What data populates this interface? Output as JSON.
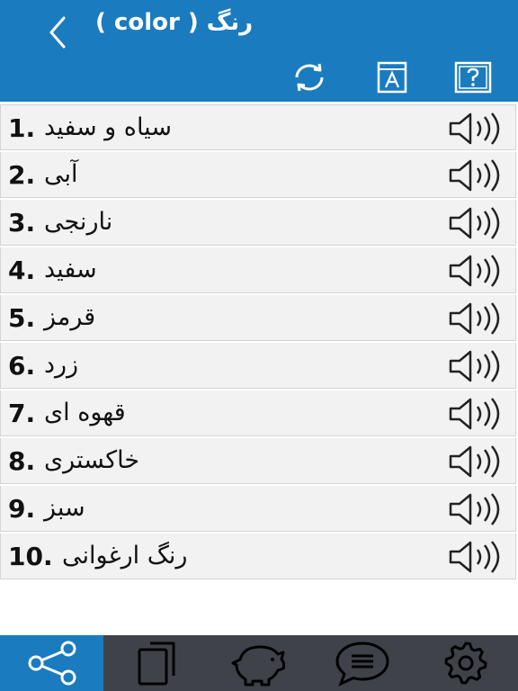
{
  "header": {
    "title": "( color ) رنگ",
    "back_icon": "chevron-left-icon",
    "tools": [
      "refresh-icon",
      "dictionary-icon",
      "help-icon"
    ],
    "color": "#1a7bbf"
  },
  "items": [
    {
      "number": "1.",
      "word": "سیاه و سفید"
    },
    {
      "number": "2.",
      "word": "آبی"
    },
    {
      "number": "3.",
      "word": "نارنجی"
    },
    {
      "number": "4.",
      "word": "سفید"
    },
    {
      "number": "5.",
      "word": "قرمز"
    },
    {
      "number": "6.",
      "word": "زرد"
    },
    {
      "number": "7.",
      "word": "قهوه ای"
    },
    {
      "number": "8.",
      "word": "خاکستری"
    },
    {
      "number": "9.",
      "word": "سبز"
    },
    {
      "number": "10.",
      "word": "رنگ ارغوانی"
    }
  ],
  "bottom_bar": {
    "tabs": [
      "share-icon",
      "copy-icon",
      "piggy-bank-icon",
      "chat-icon",
      "settings-icon"
    ],
    "active": "share-icon"
  }
}
